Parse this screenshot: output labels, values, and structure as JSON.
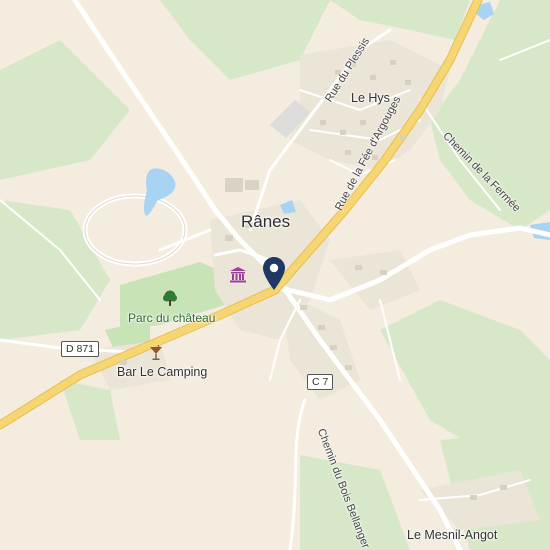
{
  "map": {
    "colors": {
      "background": "#f3ecdf",
      "forest": "#d7e8c9",
      "park": "#c8e3b6",
      "water": "#a9d3f2",
      "main_road": "#f6d673",
      "road": "#ffffff",
      "built_up": "#ebe5d8",
      "marker": "#1f3864"
    },
    "labels": {
      "town": "Rânes",
      "le_hys": "Le Hys",
      "rue_plessis": "Rue du Plessis",
      "rue_fee": "Rue de la Fée d'Argouges",
      "chemin_fermee": "Chemin de la Fermée",
      "parc": "Parc du château",
      "bar": "Bar Le Camping",
      "chemin_bois": "Chemin du Bois Bellanger",
      "mesnil": "Le Mesnil-Angot"
    },
    "route_shields": {
      "d871": "D 871",
      "c7": "C 7"
    },
    "icons": {
      "marker": "location-pin-icon",
      "museum": "museum-icon",
      "tree": "tree-icon",
      "bar": "cocktail-icon"
    }
  }
}
